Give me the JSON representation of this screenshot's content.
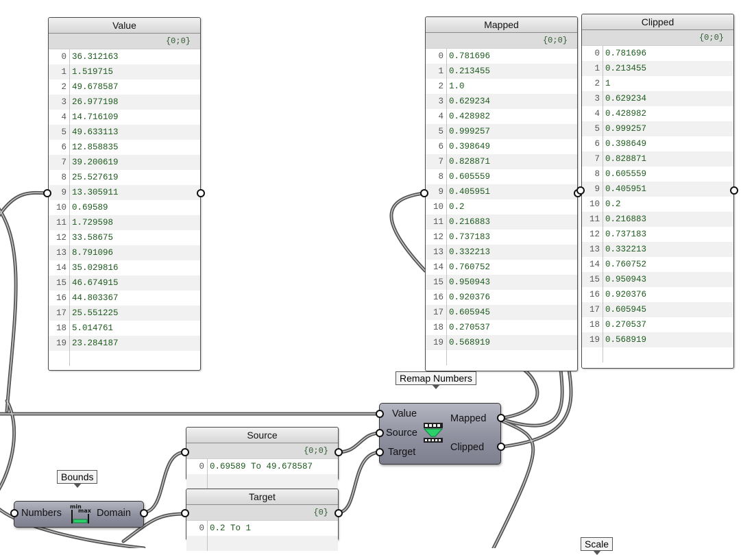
{
  "panels": {
    "value": {
      "title": "Value",
      "path": "{0;0}",
      "rows": [
        {
          "i": "0",
          "v": "36.312163"
        },
        {
          "i": "1",
          "v": "1.519715"
        },
        {
          "i": "2",
          "v": "49.678587"
        },
        {
          "i": "3",
          "v": "26.977198"
        },
        {
          "i": "4",
          "v": "14.716109"
        },
        {
          "i": "5",
          "v": "49.633113"
        },
        {
          "i": "6",
          "v": "12.858835"
        },
        {
          "i": "7",
          "v": "39.200619"
        },
        {
          "i": "8",
          "v": "25.527619"
        },
        {
          "i": "9",
          "v": "13.305911"
        },
        {
          "i": "10",
          "v": "0.69589"
        },
        {
          "i": "11",
          "v": "1.729598"
        },
        {
          "i": "12",
          "v": "33.58675"
        },
        {
          "i": "13",
          "v": "8.791096"
        },
        {
          "i": "14",
          "v": "35.029816"
        },
        {
          "i": "15",
          "v": "46.674915"
        },
        {
          "i": "16",
          "v": "44.803367"
        },
        {
          "i": "17",
          "v": "25.551225"
        },
        {
          "i": "18",
          "v": "5.014761"
        },
        {
          "i": "19",
          "v": "23.284187"
        }
      ]
    },
    "mapped": {
      "title": "Mapped",
      "path": "{0;0}",
      "rows": [
        {
          "i": "0",
          "v": "0.781696"
        },
        {
          "i": "1",
          "v": "0.213455"
        },
        {
          "i": "2",
          "v": "1.0"
        },
        {
          "i": "3",
          "v": "0.629234"
        },
        {
          "i": "4",
          "v": "0.428982"
        },
        {
          "i": "5",
          "v": "0.999257"
        },
        {
          "i": "6",
          "v": "0.398649"
        },
        {
          "i": "7",
          "v": "0.828871"
        },
        {
          "i": "8",
          "v": "0.605559"
        },
        {
          "i": "9",
          "v": "0.405951"
        },
        {
          "i": "10",
          "v": "0.2"
        },
        {
          "i": "11",
          "v": "0.216883"
        },
        {
          "i": "12",
          "v": "0.737183"
        },
        {
          "i": "13",
          "v": "0.332213"
        },
        {
          "i": "14",
          "v": "0.760752"
        },
        {
          "i": "15",
          "v": "0.950943"
        },
        {
          "i": "16",
          "v": "0.920376"
        },
        {
          "i": "17",
          "v": "0.605945"
        },
        {
          "i": "18",
          "v": "0.270537"
        },
        {
          "i": "19",
          "v": "0.568919"
        }
      ]
    },
    "clipped": {
      "title": "Clipped",
      "path": "{0;0}",
      "rows": [
        {
          "i": "0",
          "v": "0.781696"
        },
        {
          "i": "1",
          "v": "0.213455"
        },
        {
          "i": "2",
          "v": "1"
        },
        {
          "i": "3",
          "v": "0.629234"
        },
        {
          "i": "4",
          "v": "0.428982"
        },
        {
          "i": "5",
          "v": "0.999257"
        },
        {
          "i": "6",
          "v": "0.398649"
        },
        {
          "i": "7",
          "v": "0.828871"
        },
        {
          "i": "8",
          "v": "0.605559"
        },
        {
          "i": "9",
          "v": "0.405951"
        },
        {
          "i": "10",
          "v": "0.2"
        },
        {
          "i": "11",
          "v": "0.216883"
        },
        {
          "i": "12",
          "v": "0.737183"
        },
        {
          "i": "13",
          "v": "0.332213"
        },
        {
          "i": "14",
          "v": "0.760752"
        },
        {
          "i": "15",
          "v": "0.950943"
        },
        {
          "i": "16",
          "v": "0.920376"
        },
        {
          "i": "17",
          "v": "0.605945"
        },
        {
          "i": "18",
          "v": "0.270537"
        },
        {
          "i": "19",
          "v": "0.568919"
        }
      ]
    },
    "source": {
      "title": "Source",
      "path": "{0;0}",
      "rows": [
        {
          "i": "0",
          "v": "0.69589 To 49.678587"
        }
      ]
    },
    "target": {
      "title": "Target",
      "path": "{0}",
      "rows": [
        {
          "i": "0",
          "v": "0.2 To 1"
        }
      ]
    }
  },
  "remap": {
    "tag": "Remap Numbers",
    "inputs": [
      "Value",
      "Source",
      "Target"
    ],
    "outputs": [
      "Mapped",
      "Clipped"
    ],
    "icon": "remap-numbers-icon"
  },
  "bounds": {
    "tag": "Bounds",
    "input": "Numbers",
    "output": "Domain",
    "icon": "bounds-icon",
    "icon_min": "min",
    "icon_max": "max"
  },
  "scale_tag": "Scale",
  "colors": {
    "component": "#8f91a0",
    "value_text": "#1d5a1d",
    "icon_green": "#2bd06b"
  }
}
